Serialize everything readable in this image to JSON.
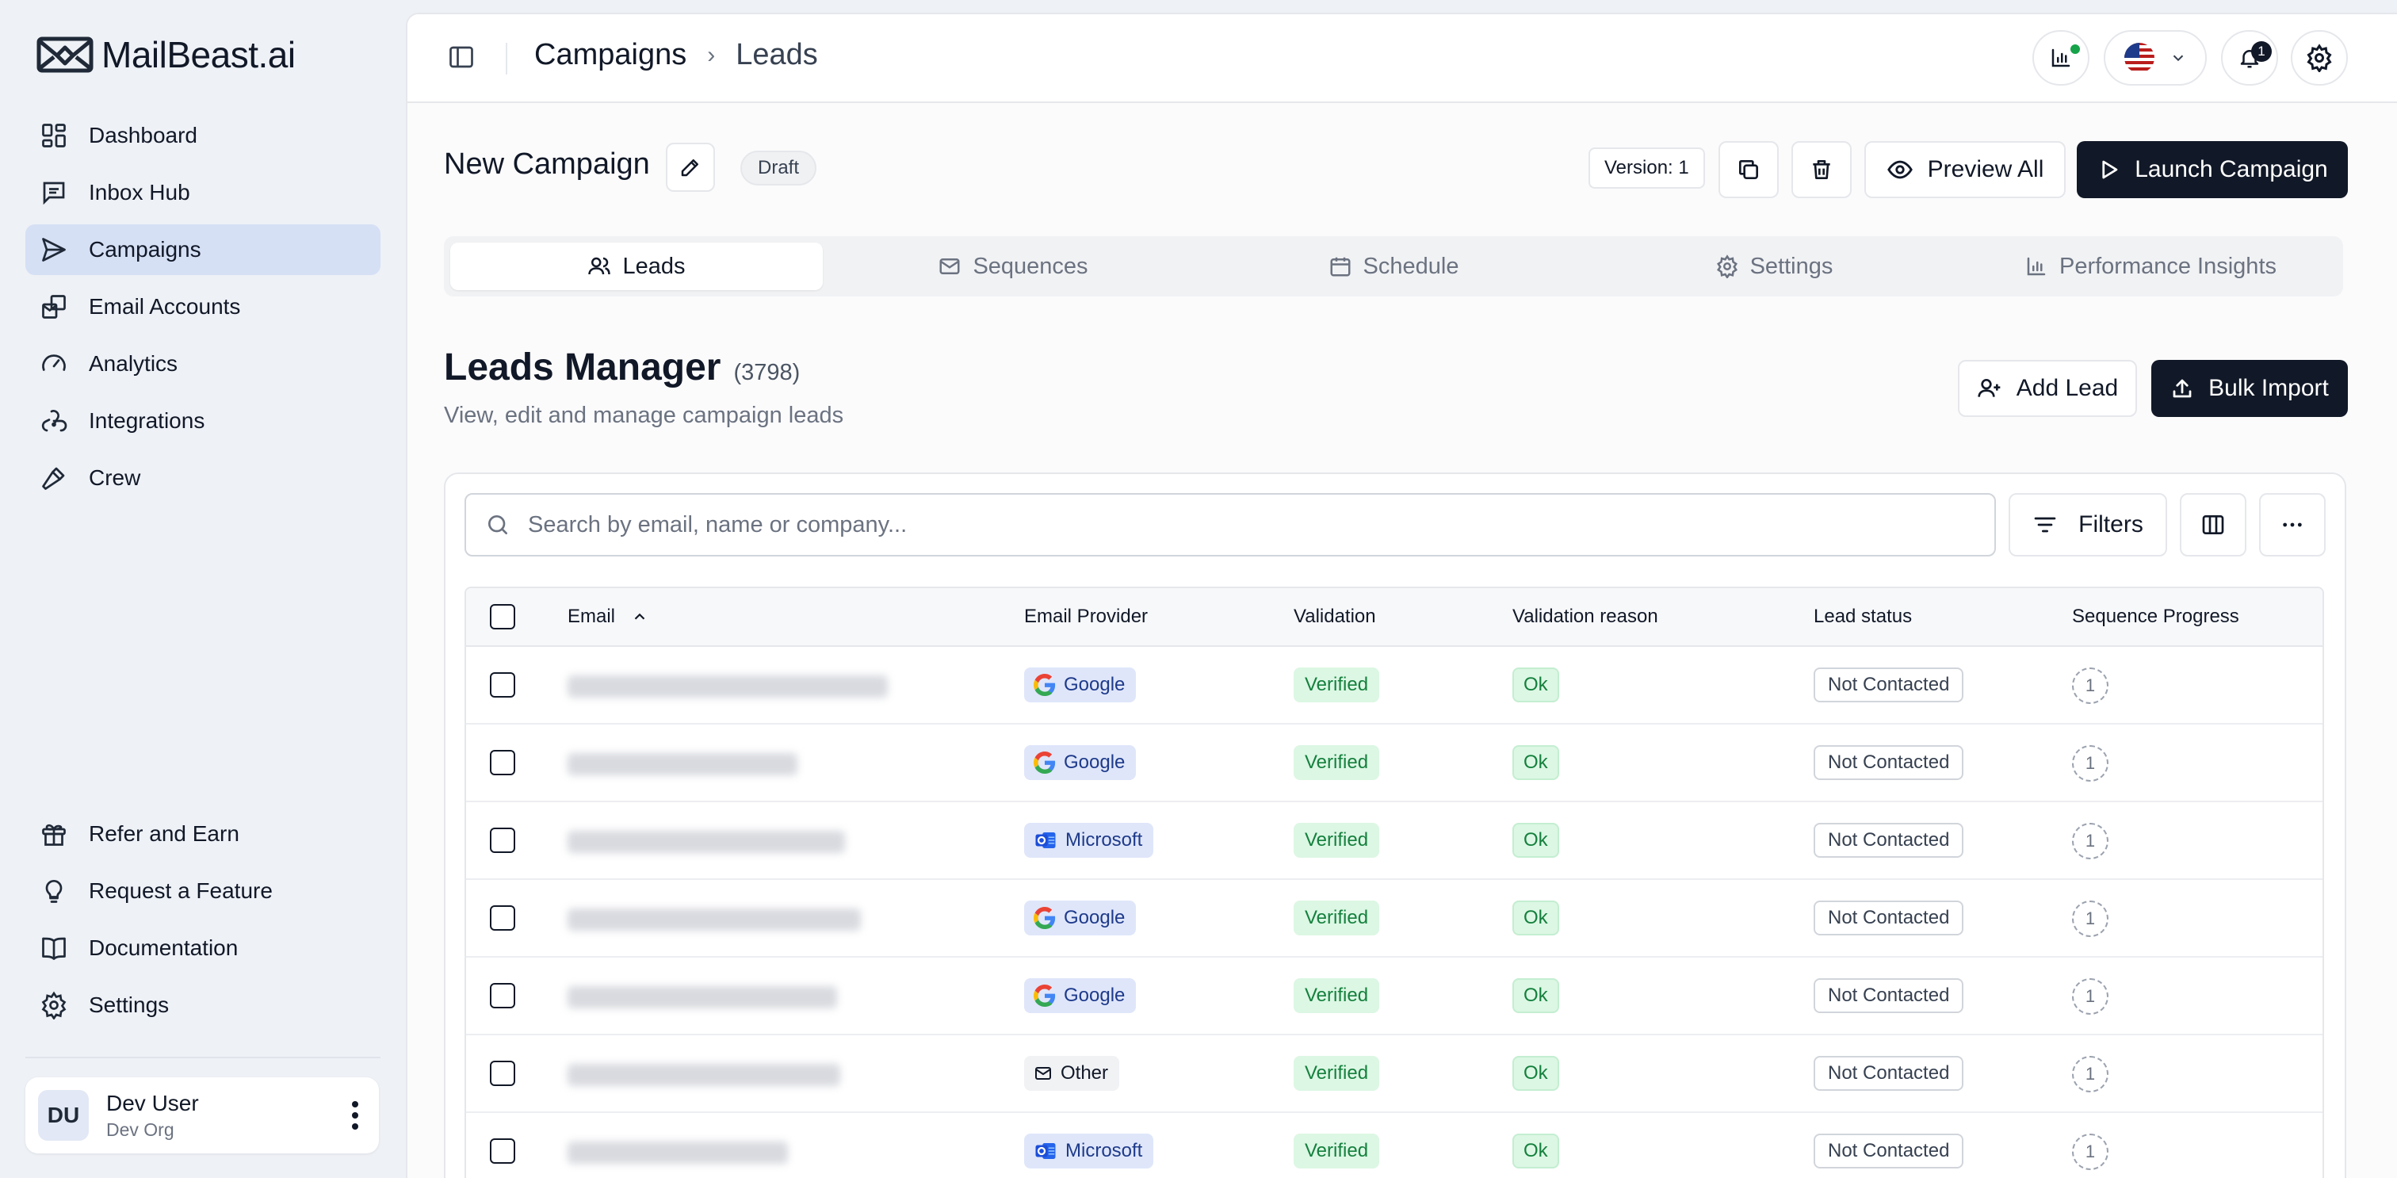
{
  "app": {
    "brand": "MailBeast.ai"
  },
  "sidebar": {
    "items": [
      {
        "label": "Dashboard",
        "icon": "dashboard-icon"
      },
      {
        "label": "Inbox Hub",
        "icon": "inbox-icon"
      },
      {
        "label": "Campaigns",
        "icon": "send-icon",
        "active": true
      },
      {
        "label": "Email Accounts",
        "icon": "email-accounts-icon"
      },
      {
        "label": "Analytics",
        "icon": "gauge-icon"
      },
      {
        "label": "Integrations",
        "icon": "webhook-icon"
      },
      {
        "label": "Crew",
        "icon": "hammer-icon"
      }
    ],
    "bottom_items": [
      {
        "label": "Refer and Earn",
        "icon": "gift-icon"
      },
      {
        "label": "Request a Feature",
        "icon": "lightbulb-icon"
      },
      {
        "label": "Documentation",
        "icon": "book-icon"
      },
      {
        "label": "Settings",
        "icon": "gear-icon"
      }
    ],
    "user": {
      "initials": "DU",
      "name": "Dev User",
      "org": "Dev Org"
    }
  },
  "topbar": {
    "breadcrumb": [
      "Campaigns",
      "Leads"
    ],
    "notification_count": "1"
  },
  "campaign": {
    "name": "New Campaign",
    "status": "Draft",
    "version": "Version: 1",
    "preview_label": "Preview All",
    "launch_label": "Launch Campaign"
  },
  "tabs": [
    {
      "label": "Leads",
      "icon": "users-icon",
      "active": true
    },
    {
      "label": "Sequences",
      "icon": "mail-icon"
    },
    {
      "label": "Schedule",
      "icon": "calendar-icon"
    },
    {
      "label": "Settings",
      "icon": "gear-icon"
    },
    {
      "label": "Performance Insights",
      "icon": "bar-chart-icon"
    }
  ],
  "leads_manager": {
    "title": "Leads Manager",
    "count": "(3798)",
    "subtitle": "View, edit and manage campaign leads",
    "add_lead_label": "Add Lead",
    "bulk_import_label": "Bulk Import",
    "search_placeholder": "Search by email, name or company...",
    "filters_label": "Filters"
  },
  "table": {
    "columns": [
      "Email",
      "Email Provider",
      "Validation",
      "Validation reason",
      "Lead status",
      "Sequence Progress"
    ],
    "rows": [
      {
        "provider": "Google",
        "provider_type": "google",
        "validation": "Verified",
        "reason": "Ok",
        "status": "Not Contacted",
        "progress": "1"
      },
      {
        "provider": "Google",
        "provider_type": "google",
        "validation": "Verified",
        "reason": "Ok",
        "status": "Not Contacted",
        "progress": "1"
      },
      {
        "provider": "Microsoft",
        "provider_type": "microsoft",
        "validation": "Verified",
        "reason": "Ok",
        "status": "Not Contacted",
        "progress": "1"
      },
      {
        "provider": "Google",
        "provider_type": "google",
        "validation": "Verified",
        "reason": "Ok",
        "status": "Not Contacted",
        "progress": "1"
      },
      {
        "provider": "Google",
        "provider_type": "google",
        "validation": "Verified",
        "reason": "Ok",
        "status": "Not Contacted",
        "progress": "1"
      },
      {
        "provider": "Other",
        "provider_type": "other",
        "validation": "Verified",
        "reason": "Ok",
        "status": "Not Contacted",
        "progress": "1"
      },
      {
        "provider": "Microsoft",
        "provider_type": "microsoft",
        "validation": "Verified",
        "reason": "Ok",
        "status": "Not Contacted",
        "progress": "1"
      }
    ]
  },
  "colors": {
    "sidebar_bg": "#eef1f6",
    "active_nav": "#d5e0f5",
    "primary_dark": "#111827",
    "verified_bg": "#dcf7e4",
    "verified_text": "#15803d",
    "provider_bg": "#dfe6fa",
    "online_dot": "#16a34a"
  }
}
